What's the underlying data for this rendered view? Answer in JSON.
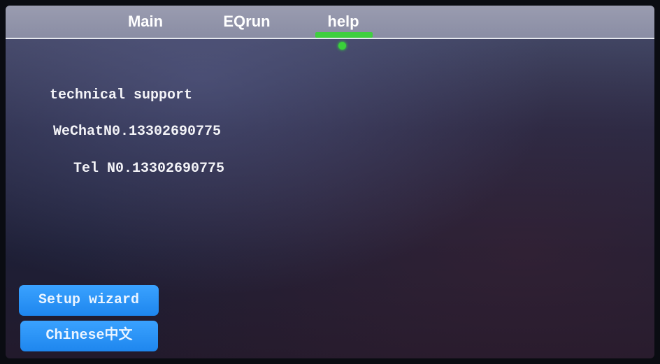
{
  "nav": {
    "tabs": [
      {
        "label": "Main"
      },
      {
        "label": "EQrun"
      },
      {
        "label": "help"
      }
    ],
    "active_tab": "help"
  },
  "help": {
    "support_title": "technical support",
    "wechat_label": "WeChatN0.",
    "wechat_number": "13302690775",
    "tel_label": "Tel N0.",
    "tel_number": "13302690775"
  },
  "buttons": {
    "setup_wizard": "Setup wizard",
    "language": "Chinese中文"
  },
  "colors": {
    "topbar": "#8a8da4",
    "active_indicator": "#3fcf3f",
    "button": "#2a94f8",
    "background": "#25273f"
  }
}
